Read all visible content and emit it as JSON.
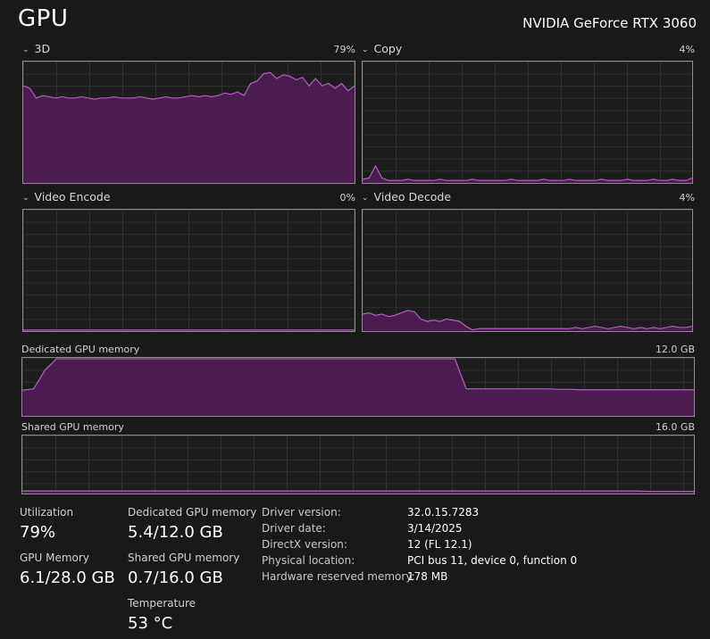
{
  "header": {
    "title": "GPU",
    "device_name": "NVIDIA GeForce RTX 3060"
  },
  "colors": {
    "accent_line": "#b85cc5",
    "accent_fill": "#4b1c4f",
    "grid": "#303030",
    "border": "#8c8c8c"
  },
  "engines": [
    {
      "label": "3D",
      "value": "79%"
    },
    {
      "label": "Copy",
      "value": "4%"
    },
    {
      "label": "Video Encode",
      "value": "0%"
    },
    {
      "label": "Video Decode",
      "value": "4%"
    }
  ],
  "memory_graphs": {
    "dedicated": {
      "label": "Dedicated GPU memory",
      "max": "12.0 GB"
    },
    "shared": {
      "label": "Shared GPU memory",
      "max": "16.0 GB"
    }
  },
  "stats": {
    "utilization": {
      "label": "Utilization",
      "value": "79%"
    },
    "dedicated_memory": {
      "label": "Dedicated GPU memory",
      "value": "5.4/12.0 GB"
    },
    "gpu_memory": {
      "label": "GPU Memory",
      "value": "6.1/28.0 GB"
    },
    "shared_memory": {
      "label": "Shared GPU memory",
      "value": "0.7/16.0 GB"
    },
    "temperature": {
      "label": "Temperature",
      "value": "53 °C"
    }
  },
  "driver_info": [
    {
      "label": "Driver version:",
      "value": "32.0.15.7283"
    },
    {
      "label": "Driver date:",
      "value": "3/14/2025"
    },
    {
      "label": "DirectX version:",
      "value": "12 (FL 12.1)"
    },
    {
      "label": "Physical location:",
      "value": "PCI bus 11, device 0, function 0"
    },
    {
      "label": "Hardware reserved memory:",
      "value": "178 MB"
    }
  ],
  "chart_data": [
    {
      "type": "area",
      "title": "3D",
      "ylim": [
        0,
        100
      ],
      "values": [
        80,
        78,
        70,
        72,
        71,
        70,
        71,
        70,
        70,
        71,
        70,
        69,
        70,
        70,
        71,
        70,
        70,
        70,
        71,
        70,
        69,
        70,
        71,
        70,
        70,
        71,
        72,
        71,
        72,
        71,
        72,
        74,
        73,
        75,
        72,
        82,
        84,
        90,
        91,
        86,
        89,
        88,
        85,
        87,
        80,
        86,
        80,
        82,
        78,
        82,
        76,
        80
      ]
    },
    {
      "type": "area",
      "title": "Copy",
      "ylim": [
        0,
        100
      ],
      "values": [
        3,
        4,
        14,
        4,
        2,
        2,
        2,
        3,
        2,
        2,
        2,
        2,
        3,
        2,
        2,
        2,
        2,
        3,
        2,
        2,
        2,
        2,
        2,
        3,
        2,
        2,
        2,
        2,
        3,
        2,
        2,
        2,
        3,
        2,
        2,
        2,
        2,
        3,
        2,
        2,
        2,
        3,
        2,
        2,
        2,
        3,
        2,
        2,
        3,
        2,
        2,
        4
      ]
    },
    {
      "type": "area",
      "title": "Video Encode",
      "ylim": [
        0,
        100
      ],
      "values": [
        0,
        0,
        0,
        0,
        0,
        0,
        0,
        0,
        0,
        0,
        0,
        0,
        0,
        0,
        0,
        0,
        0,
        0,
        0,
        0,
        0,
        0,
        0,
        0,
        0,
        0,
        0,
        0,
        0,
        0,
        0,
        0,
        0,
        0,
        0,
        0,
        0,
        0,
        0,
        0,
        0,
        0,
        0,
        0,
        0,
        0,
        0,
        0,
        0,
        0,
        0,
        0
      ]
    },
    {
      "type": "area",
      "title": "Video Decode",
      "ylim": [
        0,
        100
      ],
      "values": [
        14,
        15,
        13,
        14,
        12,
        13,
        15,
        17,
        16,
        10,
        8,
        9,
        8,
        10,
        9,
        8,
        4,
        1,
        2,
        2,
        2,
        2,
        2,
        2,
        2,
        2,
        2,
        2,
        2,
        2,
        2,
        2,
        2,
        3,
        2,
        3,
        4,
        3,
        2,
        3,
        4,
        3,
        2,
        3,
        2,
        3,
        2,
        3,
        4,
        3,
        3,
        4
      ]
    },
    {
      "type": "area",
      "title": "Dedicated GPU memory",
      "ylim": [
        0,
        12.0
      ],
      "values": [
        5.3,
        5.6,
        9.5,
        11.8,
        11.8,
        11.8,
        11.8,
        11.8,
        11.8,
        11.8,
        11.8,
        11.8,
        11.8,
        11.8,
        11.8,
        11.8,
        11.8,
        11.8,
        11.8,
        11.8,
        11.8,
        11.8,
        11.8,
        11.8,
        11.8,
        11.8,
        11.8,
        11.8,
        11.8,
        11.8,
        11.8,
        11.8,
        11.8,
        11.8,
        11.8,
        11.8,
        11.8,
        11.8,
        11.8,
        5.6,
        5.6,
        5.6,
        5.6,
        5.6,
        5.6,
        5.6,
        5.6,
        5.5,
        5.5,
        5.4,
        5.4,
        5.4,
        5.4,
        5.4,
        5.4,
        5.4,
        5.4,
        5.4,
        5.4,
        5.4
      ]
    },
    {
      "type": "area",
      "title": "Shared GPU memory",
      "ylim": [
        0,
        16.0
      ],
      "values": [
        0.7,
        0.7,
        0.7,
        0.7,
        0.7,
        0.7,
        0.7,
        0.7,
        0.7,
        0.7,
        0.7,
        0.7,
        0.7,
        0.7,
        0.7,
        0.7,
        0.7,
        0.7,
        0.7,
        0.7,
        0.7,
        0.7,
        0.7,
        0.7,
        0.7,
        0.7,
        0.7,
        0.7,
        0.7,
        0.7,
        0.7,
        0.7,
        0.7,
        0.7,
        0.7,
        0.7,
        0.7,
        0.7,
        0.7,
        0.7,
        0.7,
        0.7,
        0.7,
        0.7,
        0.7,
        0.7,
        0.7,
        0.7,
        0.7,
        0.7,
        0.7,
        0.7,
        0.7,
        0.7,
        0.7,
        0.6,
        0.6,
        0.6,
        0.6,
        0.6
      ]
    }
  ]
}
